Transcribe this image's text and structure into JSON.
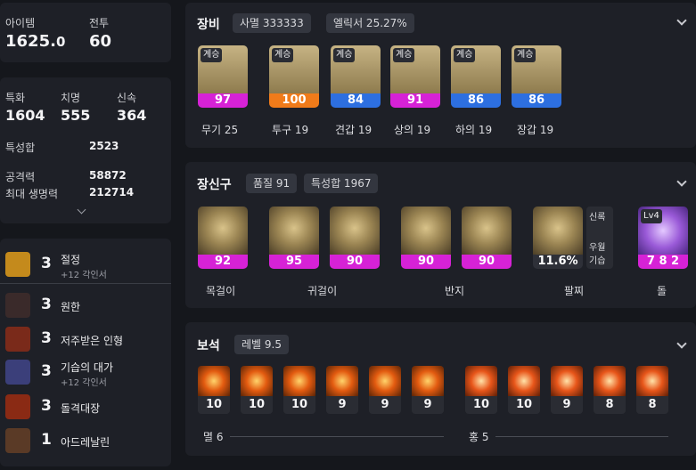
{
  "summary": {
    "item_label": "아이템",
    "item_value_main": "1625.",
    "item_value_dec": "0",
    "combat_label": "전투",
    "combat_value": "60"
  },
  "stats": {
    "crit_label": "특화",
    "crit_value": "1604",
    "chi_label": "치명",
    "chi_value": "555",
    "swift_label": "신속",
    "swift_value": "364",
    "total_label": "특성합",
    "total_value": "2523",
    "atk_label": "공격력",
    "atk_value": "58872",
    "hp_label": "최대 생명력",
    "hp_value": "212714"
  },
  "engravings": [
    {
      "level": "3",
      "name": "절정",
      "sub": "+12 각인서",
      "icon_color": "#c48a1c"
    },
    {
      "level": "3",
      "name": "원한",
      "sub": "",
      "icon_color": "#3a2a2a"
    },
    {
      "level": "3",
      "name": "저주받은 인형",
      "sub": "",
      "icon_color": "#7a2a1a"
    },
    {
      "level": "3",
      "name": "기습의 대가",
      "sub": "+12 각인서",
      "icon_color": "#3b3f7a"
    },
    {
      "level": "3",
      "name": "돌격대장",
      "sub": "",
      "icon_color": "#8a2a14"
    },
    {
      "level": "1",
      "name": "아드레날린",
      "sub": "",
      "icon_color": "#5a3a26"
    }
  ],
  "equipment": {
    "title": "장비",
    "chip1": "사멸 333333",
    "chip2": "엘릭서 25.27%",
    "items": [
      {
        "tag": "계승",
        "quality": "97",
        "label": "무기 25",
        "bar": "magenta"
      },
      {
        "tag": "계승",
        "quality": "100",
        "label": "투구 19",
        "bar": "orange"
      },
      {
        "tag": "계승",
        "quality": "84",
        "label": "견갑 19",
        "bar": "blue"
      },
      {
        "tag": "계승",
        "quality": "91",
        "label": "상의 19",
        "bar": "magenta"
      },
      {
        "tag": "계승",
        "quality": "86",
        "label": "하의 19",
        "bar": "blue"
      },
      {
        "tag": "계승",
        "quality": "86",
        "label": "장갑 19",
        "bar": "blue"
      }
    ]
  },
  "accessories": {
    "title": "장신구",
    "chip1": "품질 91",
    "chip2": "특성합 1967",
    "items": [
      {
        "quality": "92"
      },
      {
        "quality": "95"
      },
      {
        "quality": "90"
      },
      {
        "quality": "90"
      },
      {
        "quality": "90"
      },
      {
        "quality": "11.6%"
      },
      {
        "quality": "7 8 2",
        "tag": "Lv4"
      }
    ],
    "labels": {
      "necklace": "목걸이",
      "earring": "귀걸이",
      "ring": "반지",
      "bracelet": "팔찌",
      "stone": "돌"
    },
    "bracelet_stats": [
      "신록",
      "우월",
      "기습"
    ]
  },
  "gems": {
    "title": "보석",
    "chip1": "레벨 9.5",
    "left": [
      "10",
      "10",
      "10",
      "9",
      "9",
      "9"
    ],
    "right": [
      "10",
      "10",
      "9",
      "8",
      "8"
    ],
    "left_label": "멸 6",
    "right_label": "홍 5"
  }
}
